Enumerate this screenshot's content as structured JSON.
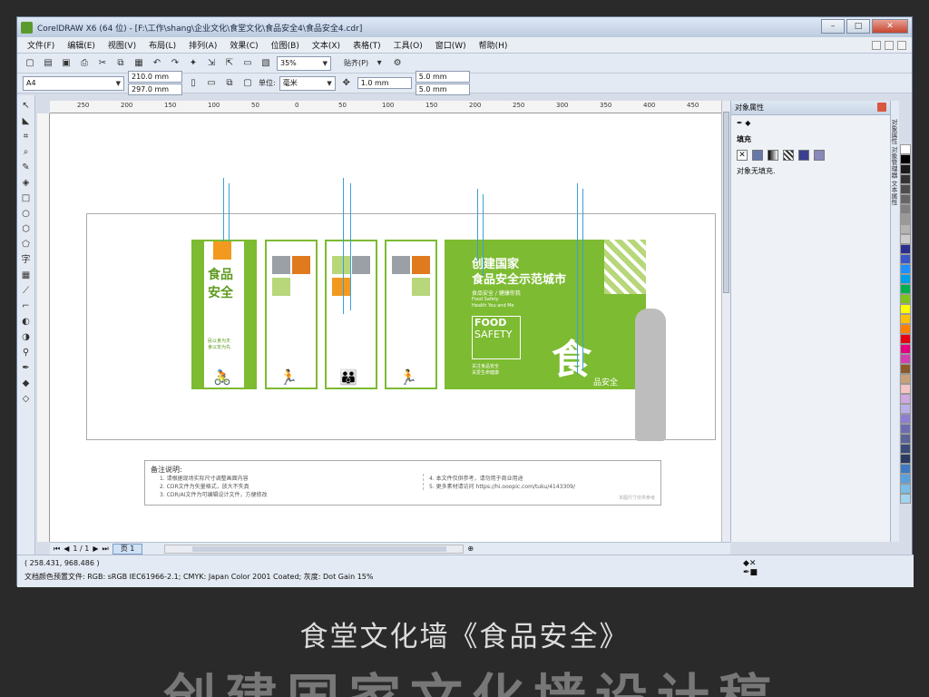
{
  "window": {
    "title": "CorelDRAW X6 (64 位) - [F:\\工作\\shang\\企业文化\\食堂文化\\食品安全4\\食品安全4.cdr]",
    "controls": [
      "–",
      "□",
      "✕"
    ]
  },
  "menu": [
    "文件(F)",
    "编辑(E)",
    "视图(V)",
    "布局(L)",
    "排列(A)",
    "效果(C)",
    "位图(B)",
    "文本(X)",
    "表格(T)",
    "工具(O)",
    "窗口(W)",
    "帮助(H)"
  ],
  "toolbar1": {
    "zoom": "35%",
    "snap": "贴齐(P)"
  },
  "toolbar2": {
    "page_size": "A4",
    "width": "210.0 mm",
    "height": "297.0 mm",
    "unit_label": "单位:",
    "unit": "毫米",
    "nudge": "1.0 mm",
    "dup_x": "5.0 mm",
    "dup_y": "5.0 mm"
  },
  "ruler_ticks": [
    "250",
    "200",
    "150",
    "100",
    "50",
    "0",
    "50",
    "100",
    "150",
    "200",
    "250",
    "300",
    "350",
    "400",
    "450"
  ],
  "artwork": {
    "headline1": "创建国家",
    "headline2": "食品安全示范城市",
    "sub1": "食品安全 / 健康你我",
    "sub2": "Food Safety",
    "sub3": "Health You and Me",
    "food": "FOOD",
    "safety": "SAFETY",
    "slogan1": "关注食品安全",
    "slogan2": "关爱生命健康",
    "big_char": "食",
    "big_rest": "品安全",
    "panel1_title": "食品安全",
    "panel1_sub1": "民以食为天",
    "panel1_sub2": "食以安为先"
  },
  "notes": {
    "heading": "备注说明:",
    "left": [
      "1. 请根据现场实际尺寸调整画面内容",
      "2. CDR文件为矢量格式，放大不失真",
      "3. CDR/AI文件为可编辑设计文件，方便修改"
    ],
    "right": [
      "4. 本文件仅供参考，请勿用于商业用途",
      "5. 更多素材请访问 https://hi.ooopic.com/tuku/4143309/"
    ],
    "corner": "本图尺寸仅供参考"
  },
  "page_nav": {
    "pos": "1 / 1",
    "tab": "页 1"
  },
  "status": {
    "coords": "( 258.431, 968.486 )",
    "profile": "文档颜色预置文件: RGB: sRGB IEC61966-2.1; CMYK: Japan Color 2001 Coated; 灰度: Dot Gain 15%"
  },
  "dock": {
    "title": "对象属性",
    "fill_section": "填充",
    "no_fill_text": "对象无填充."
  },
  "side_tabs": "对象属性  对象管理器  文本属性",
  "palette": [
    "#ffffff",
    "#000000",
    "#1a1a1a",
    "#333333",
    "#4d4d4d",
    "#666666",
    "#808080",
    "#999999",
    "#b3b3b3",
    "#cccccc",
    "#2b2e8f",
    "#3b56c8",
    "#1e90ff",
    "#00a0e9",
    "#00b050",
    "#7fc31c",
    "#ffff00",
    "#ffc000",
    "#ff7f00",
    "#e60012",
    "#e5007f",
    "#d13fb1",
    "#8b5a2b",
    "#c8a07a",
    "#f4c3c3",
    "#cfa8e0",
    "#b9b0e8",
    "#8c7fd0",
    "#6e6bb3",
    "#5a6496",
    "#3a4a7a",
    "#2a3a60",
    "#3d7ac1",
    "#5aa0dd",
    "#7abde8",
    "#a3d3f0"
  ],
  "caption": "食堂文化墙《食品安全》",
  "bigtext": "创建国家文化墙设计稿"
}
